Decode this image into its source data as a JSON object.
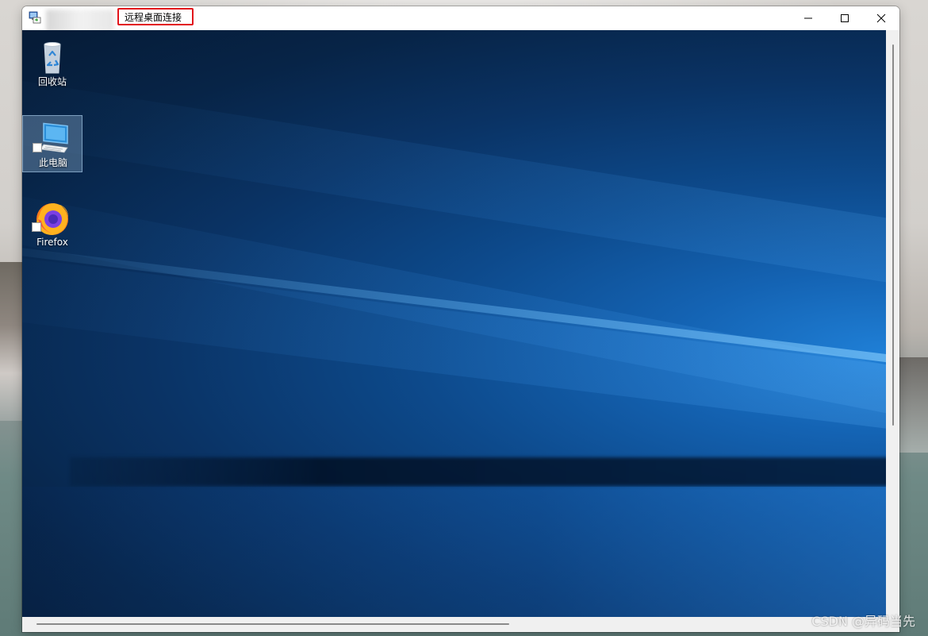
{
  "window": {
    "title": "远程桌面连接",
    "icons": {
      "app": "remote-desktop-icon",
      "minimize": "minimize-icon",
      "maximize": "maximize-icon",
      "close": "close-icon"
    }
  },
  "desktop": {
    "icons": [
      {
        "label": "回收站",
        "icon": "recycle-bin-icon",
        "selected": false
      },
      {
        "label": "此电脑",
        "icon": "this-pc-icon",
        "selected": true
      },
      {
        "label": "Firefox",
        "icon": "firefox-icon",
        "selected": false
      }
    ]
  },
  "watermark": "CSDN @异码当先",
  "colors": {
    "highlight_border": "#e2141b",
    "titlebar": "#ffffff",
    "scrollbar": "#f0f0f0"
  }
}
